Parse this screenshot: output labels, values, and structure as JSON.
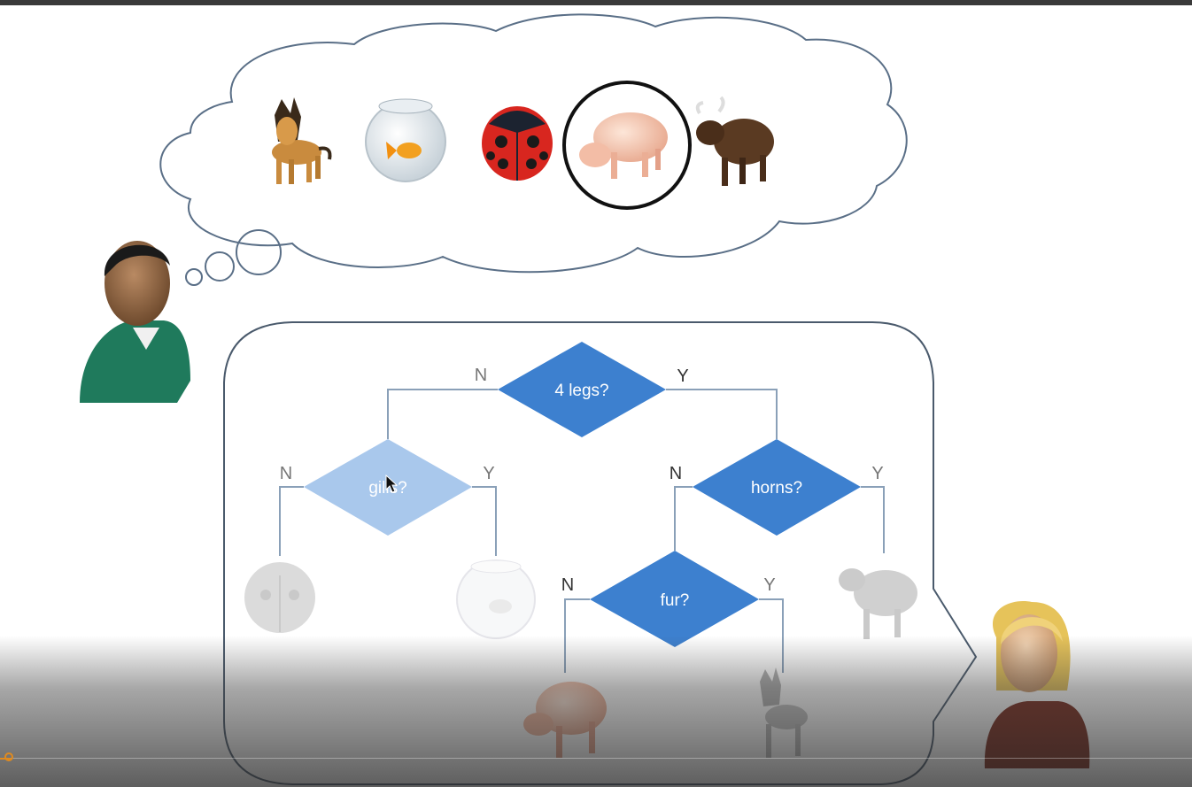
{
  "decision_tree": {
    "root": {
      "question": "4 legs?",
      "no_label": "N",
      "yes_label": "Y"
    },
    "left": {
      "question": "gills?",
      "no_label": "N",
      "yes_label": "Y"
    },
    "right": {
      "question": "horns?",
      "no_label": "N",
      "yes_label": "Y"
    },
    "right_no": {
      "question": "fur?",
      "no_label": "N",
      "yes_label": "Y"
    }
  },
  "thought_animals": [
    "dog",
    "goldfish",
    "ladybug",
    "pig",
    "bull"
  ],
  "selected_animal": "pig",
  "colors": {
    "diamond": "#3d80cf",
    "diamond_faded": "#a9c8ec",
    "line": "#8aa0b8",
    "bubble_stroke": "#5a6f87"
  }
}
